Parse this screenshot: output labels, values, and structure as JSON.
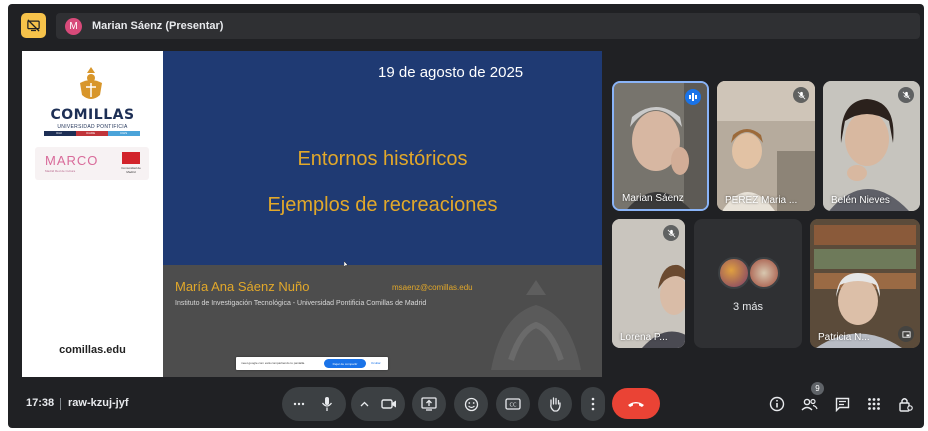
{
  "topbar": {
    "presenter_initial": "M",
    "presenter_label": "Marian Sáenz (Presentar)"
  },
  "slide": {
    "logo_name": "COMILLAS",
    "logo_sub": "UNIVERSIDAD PONTIFICIA",
    "logo_strip": [
      "ICAI",
      "ICADE",
      "CIHS"
    ],
    "marco_name": "MARCO",
    "marco_sub": "Madrid Red de Cultura",
    "madrid_text": "Comunidad de Madrid",
    "site_url": "comillas.edu",
    "date": "19 de agosto de 2025",
    "title_line1": "Entornos históricos",
    "title_line2": "Ejemplos de recreaciones",
    "author": "María Ana Sáenz Nuño",
    "email": "msaenz@comillas.edu",
    "institution": "Instituto de Investigación Tecnológica - Universidad Pontificia Comillas de Madrid",
    "share_popup": {
      "text": "meet.google.com está compartiendo tu pantalla.",
      "stop_label": "Dejar de compartir",
      "hide_label": "Ocultar"
    }
  },
  "participants": [
    {
      "name": "Marian Sáenz",
      "status": "speaking"
    },
    {
      "name": "PEREZ Maria ...",
      "status": "muted"
    },
    {
      "name": "Belén Nieves",
      "status": "muted"
    },
    {
      "name": "Lorena P...",
      "status": "muted"
    },
    {
      "name": "Patricia N...",
      "status": "muted"
    }
  ],
  "overflow": {
    "label": "3 más"
  },
  "bottombar": {
    "time": "17:38",
    "meeting_code": "raw-kzuj-jyf",
    "people_count": "9"
  },
  "colors": {
    "background": "#202124",
    "control": "#3c4043",
    "end_call": "#ea4335",
    "accent": "#1a73e8",
    "present_badge": "#f6c24a",
    "slide_blue": "#1f3a73",
    "slide_gold": "#e2a82a"
  },
  "icons": [
    "present-off-icon",
    "more-options-icon",
    "microphone-icon",
    "chevron-up-icon",
    "camera-icon",
    "present-screen-icon",
    "emoji-icon",
    "captions-icon",
    "raise-hand-icon",
    "more-vert-icon",
    "end-call-icon",
    "info-icon",
    "people-icon",
    "chat-icon",
    "activities-icon",
    "host-controls-icon",
    "mic-off-icon",
    "audio-level-icon",
    "pin-icon"
  ]
}
